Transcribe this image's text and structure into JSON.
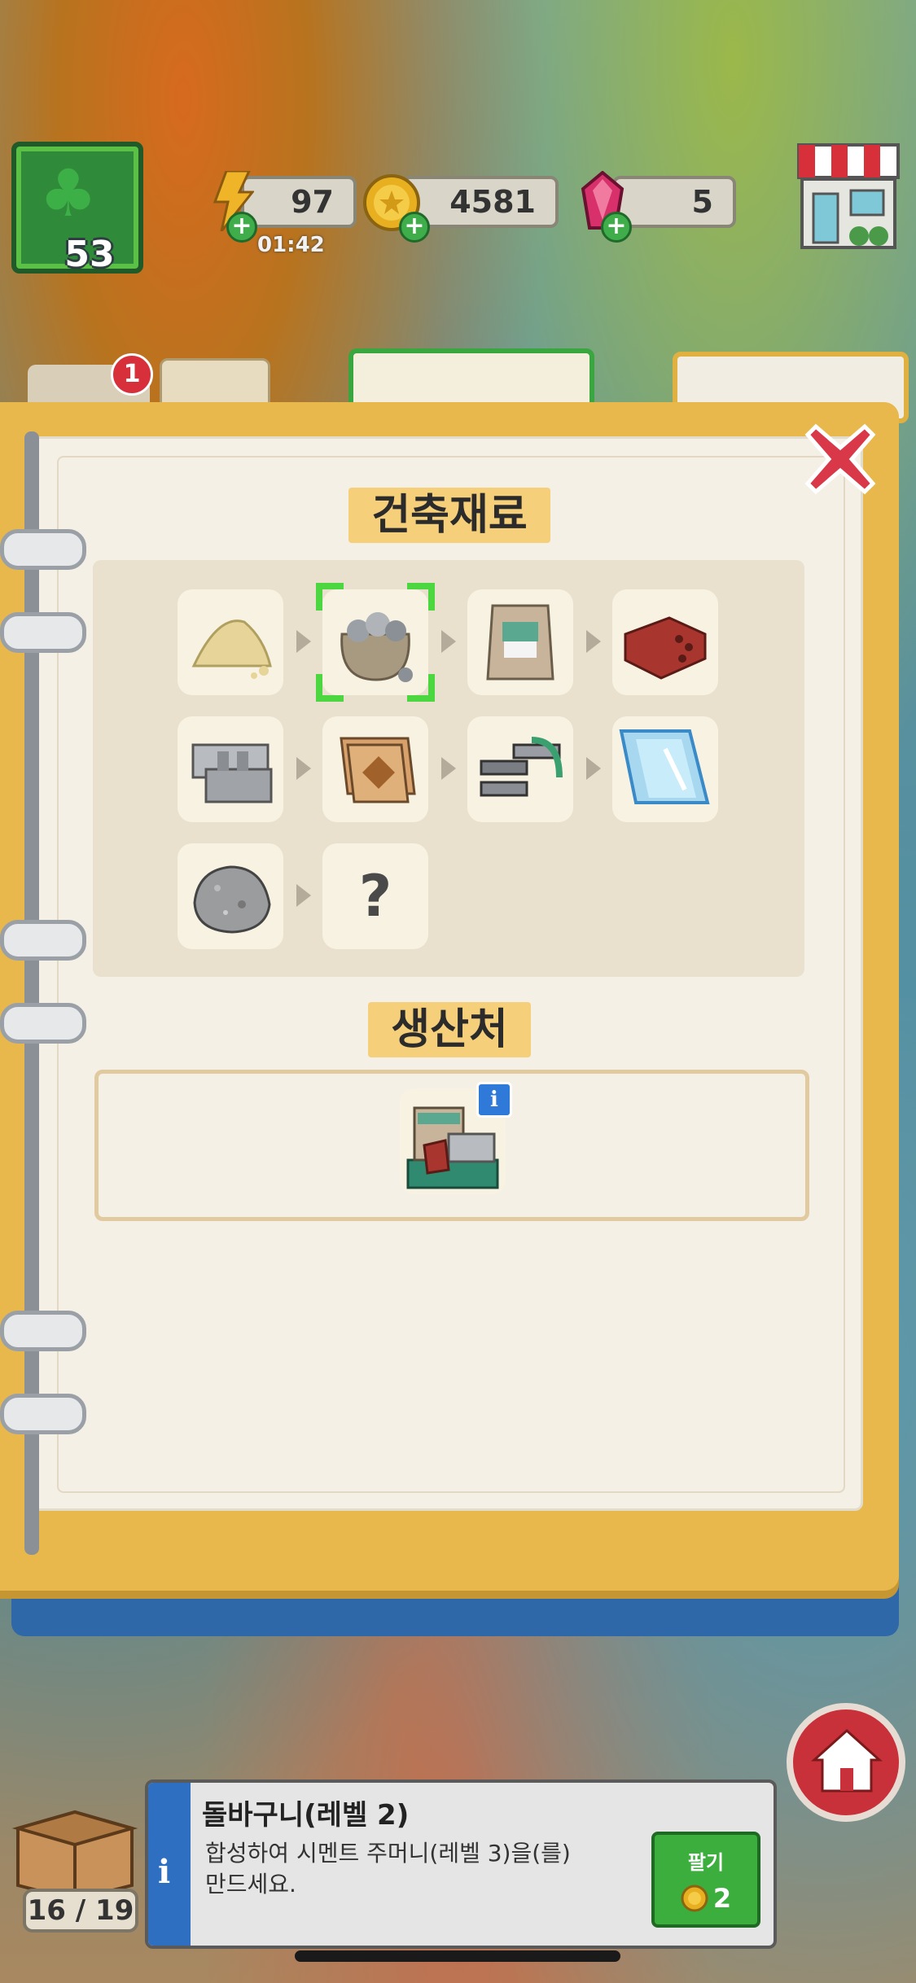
{
  "hud": {
    "level": "53",
    "energy": {
      "value": "97",
      "timer": "01:42"
    },
    "coins": {
      "value": "4581"
    },
    "gems": {
      "value": "5"
    },
    "background_badge_count": "1"
  },
  "book": {
    "section1_title": "건축재료",
    "section2_title": "생산처",
    "unknown_slot": "?",
    "items_row1": [
      "sand-icon",
      "stone-bag-icon",
      "cement-bag-icon",
      "brick-icon"
    ],
    "items_row2": [
      "concrete-block-icon",
      "tile-icon",
      "steel-beam-icon",
      "glass-pane-icon"
    ],
    "items_row3": [
      "rock-icon",
      "unknown-icon"
    ],
    "producer": "building-materials-producer-icon"
  },
  "bottom": {
    "box_count": "16 / 19",
    "item_title": "돌바구니(레벨 2)",
    "item_desc_line1": "합성하여 시멘트 주머니(레벨 3)을(를)",
    "item_desc_line2": "만드세요.",
    "sell_label": "팔기",
    "sell_price": "2"
  },
  "colors": {
    "accent_green": "#3cae3e",
    "book_gold": "#e8b84c",
    "close_red": "#d83848",
    "info_blue": "#2f6fc2"
  }
}
